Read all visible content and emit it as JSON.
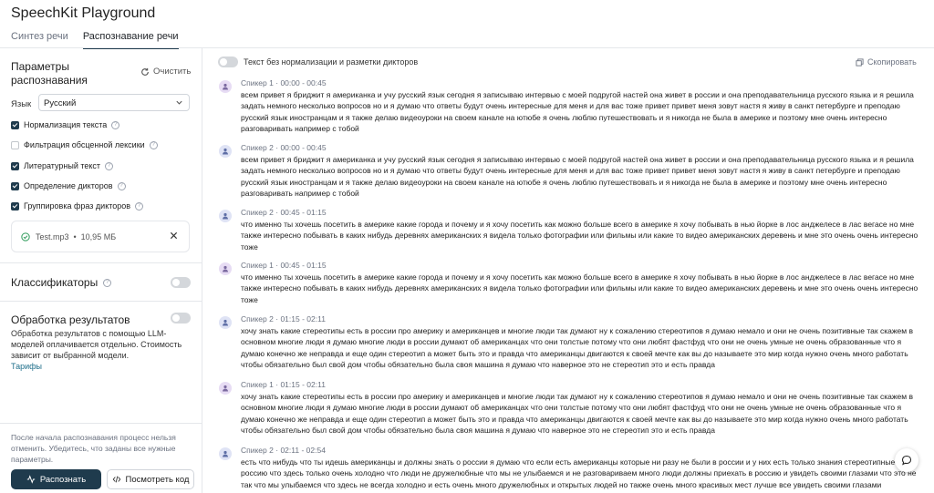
{
  "app": {
    "title": "SpeechKit Playground"
  },
  "tabs": [
    {
      "label": "Синтез речи",
      "active": false
    },
    {
      "label": "Распознавание речи",
      "active": true
    }
  ],
  "sidebar": {
    "params_title": "Параметры распознавания",
    "clear_label": "Очистить",
    "language": {
      "label": "Язык",
      "value": "Русский"
    },
    "options": [
      {
        "label": "Нормализация текста",
        "checked": true
      },
      {
        "label": "Фильтрация обсценной лексики",
        "checked": false
      },
      {
        "label": "Литературный текст",
        "checked": true
      },
      {
        "label": "Определение дикторов",
        "checked": true
      },
      {
        "label": "Группировка фраз дикторов",
        "checked": true
      }
    ],
    "file": {
      "name": "Test.mp3",
      "separator": "•",
      "size": "10,95 МБ"
    },
    "classifiers_title": "Классификаторы",
    "classifiers_enabled": false,
    "llm_title": "Обработка результатов",
    "llm_enabled": false,
    "llm_description": "Обработка результатов с помощью LLM-моделей оплачивается отдельно. Стоимость зависит от выбранной модели.",
    "tariffs_link": "Тарифы",
    "notice": "После начала распознавания процесс нельзя отменить. Убедитесь, что заданы все нужные параметры.",
    "recognize_button": "Распознать",
    "view_code_button": "Посмотреть код"
  },
  "main": {
    "raw_text_toggle_label": "Текст без нормализации и разметки дикторов",
    "raw_text_enabled": false,
    "copy_label": "Скопировать",
    "entries": [
      {
        "speaker": "Спикер 1",
        "sep": "·",
        "time": "00:00 - 00:45",
        "avatar": "s1",
        "text": "всем привет я бриджит я американка и учу русский язык сегодня я записываю интервью с моей подругой настей она живет в россии и она преподавательница русского языка и я решила задать немного несколько вопросов но и я думаю что ответы будут очень интересные для меня и для вас тоже привет привет меня зовут настя я живу в санкт петербурге и преподаю русский язык иностранцам и я также делаю видеоуроки на своем канале на ютюбе я очень люблю путешествовать и я никогда не была в америке и поэтому мне очень интересно разговаривать например с тобой"
      },
      {
        "speaker": "Спикер 2",
        "sep": "·",
        "time": "00:00 - 00:45",
        "avatar": "s2",
        "text": "всем привет я бриджит я американка и учу русский язык сегодня я записываю интервью с моей подругой настей она живет в россии и она преподавательница русского языка и я решила задать немного несколько вопросов но и я думаю что ответы будут очень интересные для меня и для вас тоже привет привет меня зовут настя я живу в санкт петербурге и преподаю русский язык иностранцам и я также делаю видеоуроки на своем канале на ютюбе я очень люблю путешествовать и я никогда не была в америке и поэтому мне очень интересно разговаривать например с тобой"
      },
      {
        "speaker": "Спикер 2",
        "sep": "·",
        "time": "00:45 - 01:15",
        "avatar": "s2",
        "text": "что именно ты хочешь посетить в америке какие города и почему и я хочу посетить как можно больше всего в америке я хочу побывать в нью йорке в лос анджелесе в лас вегасе но мне также интересно побывать в каких нибудь деревнях американских я видела только фотографии или фильмы или какие то видео американских деревень и мне это очень очень интересно тоже"
      },
      {
        "speaker": "Спикер 1",
        "sep": "·",
        "time": "00:45 - 01:15",
        "avatar": "s1",
        "text": "что именно ты хочешь посетить в америке какие города и почему и я хочу посетить как можно больше всего в америке я хочу побывать в нью йорке в лос анджелесе в лас вегасе но мне также интересно побывать в каких нибудь деревнях американских я видела только фотографии или фильмы или какие то видео американских деревень и мне это очень очень интересно тоже"
      },
      {
        "speaker": "Спикер 2",
        "sep": "·",
        "time": "01:15 - 02:11",
        "avatar": "s2",
        "text": "хочу знать какие стереотипы есть в россии про америку и американцев и многие люди так думают ну к сожалению стереотипов я думаю немало и они не очень позитивные так скажем в основном многие люди я думаю многие люди в россии думают об американцах что они толстые потому что они любят фастфуд что они не очень умные не очень образованные что я думаю конечно же неправда и еще один стереотип а может быть это и правда что американцы двигаются к своей мечте как вы до называете это мир когда нужно очень много работать чтобы обязательно был свой дом чтобы обязательно была своя машина я думаю что наверное это не стереотип это и есть правда"
      },
      {
        "speaker": "Спикер 1",
        "sep": "·",
        "time": "01:15 - 02:11",
        "avatar": "s1",
        "text": "хочу знать какие стереотипы есть в россии про америку и американцев и многие люди так думают ну к сожалению стереотипов я думаю немало и они не очень позитивные так скажем в основном многие люди я думаю многие люди в россии думают об американцах что они толстые потому что они любят фастфуд что они не очень умные не очень образованные что я думаю конечно же неправда и еще один стереотип а может быть это и правда что американцы двигаются к своей мечте как вы до называете это мир когда нужно очень много работать чтобы обязательно был свой дом чтобы обязательно была своя машина я думаю что наверное это не стереотип это и есть правда"
      },
      {
        "speaker": "Спикер 2",
        "sep": "·",
        "time": "02:11 - 02:54",
        "avatar": "s2",
        "text": "есть что нибудь что ты идешь американцы и должны знать о россии я думаю что если есть американцы которые ни разу не были в россии и у них есть только знания стереотипные про россию что здесь только очень холодно что люди не дружелюбные что мы не улыбаемся и не разговариваем много люди должны приехать в россию и увидеть своими глазами что это не так что мы улыбаемся что здесь не всегда холодно и есть очень много дружелюбных и открытых людей но также очень много красивых мест лучше все увидеть своими глазами"
      }
    ]
  }
}
